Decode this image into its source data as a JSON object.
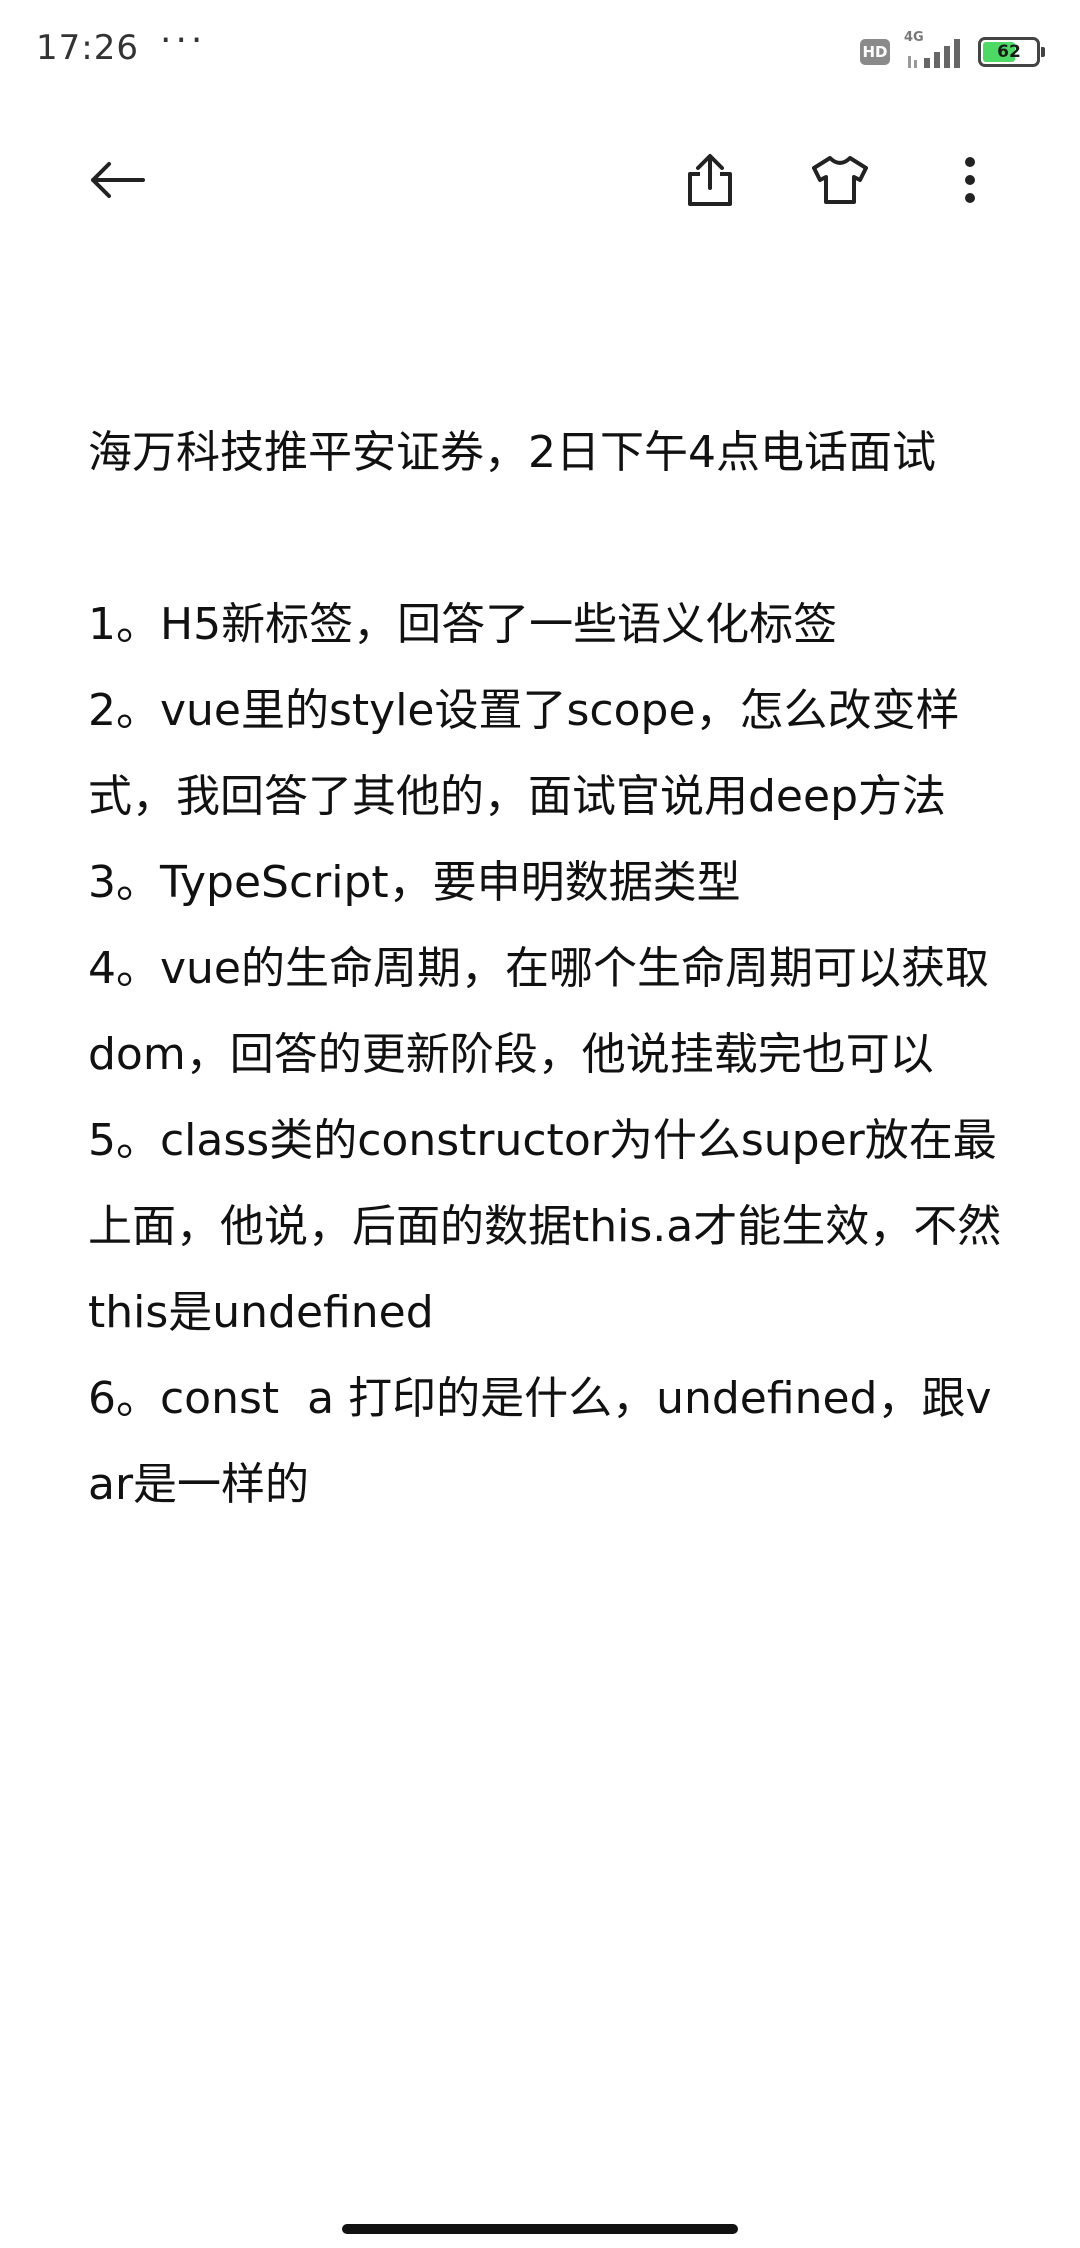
{
  "status_bar": {
    "time": "17:26",
    "more": "···",
    "hd": "HD",
    "network": "4G",
    "battery": "62",
    "battery_level": 0.62
  },
  "toolbar": {
    "back_icon": "arrow-left-icon",
    "share_icon": "share-icon",
    "theme_icon": "tshirt-icon",
    "menu_icon": "more-vertical-icon"
  },
  "note": {
    "title": "海万科技推平安证券，2日下午4点电话面试",
    "items": [
      "1。H5新标签，回答了一些语义化标签",
      "2。vue里的style设置了scope，怎么改变样式，我回答了其他的，面试官说用deep方法",
      "3。TypeScript，要申明数据类型",
      "4。vue的生命周期，在哪个生命周期可以获取dom，回答的更新阶段，他说挂载完也可以",
      "5。class类的constructor为什么super放在最上面，他说，后面的数据this.a才能生效，不然this是undefined",
      "6。const  a 打印的是什么，undefined，跟var是一样的"
    ]
  }
}
